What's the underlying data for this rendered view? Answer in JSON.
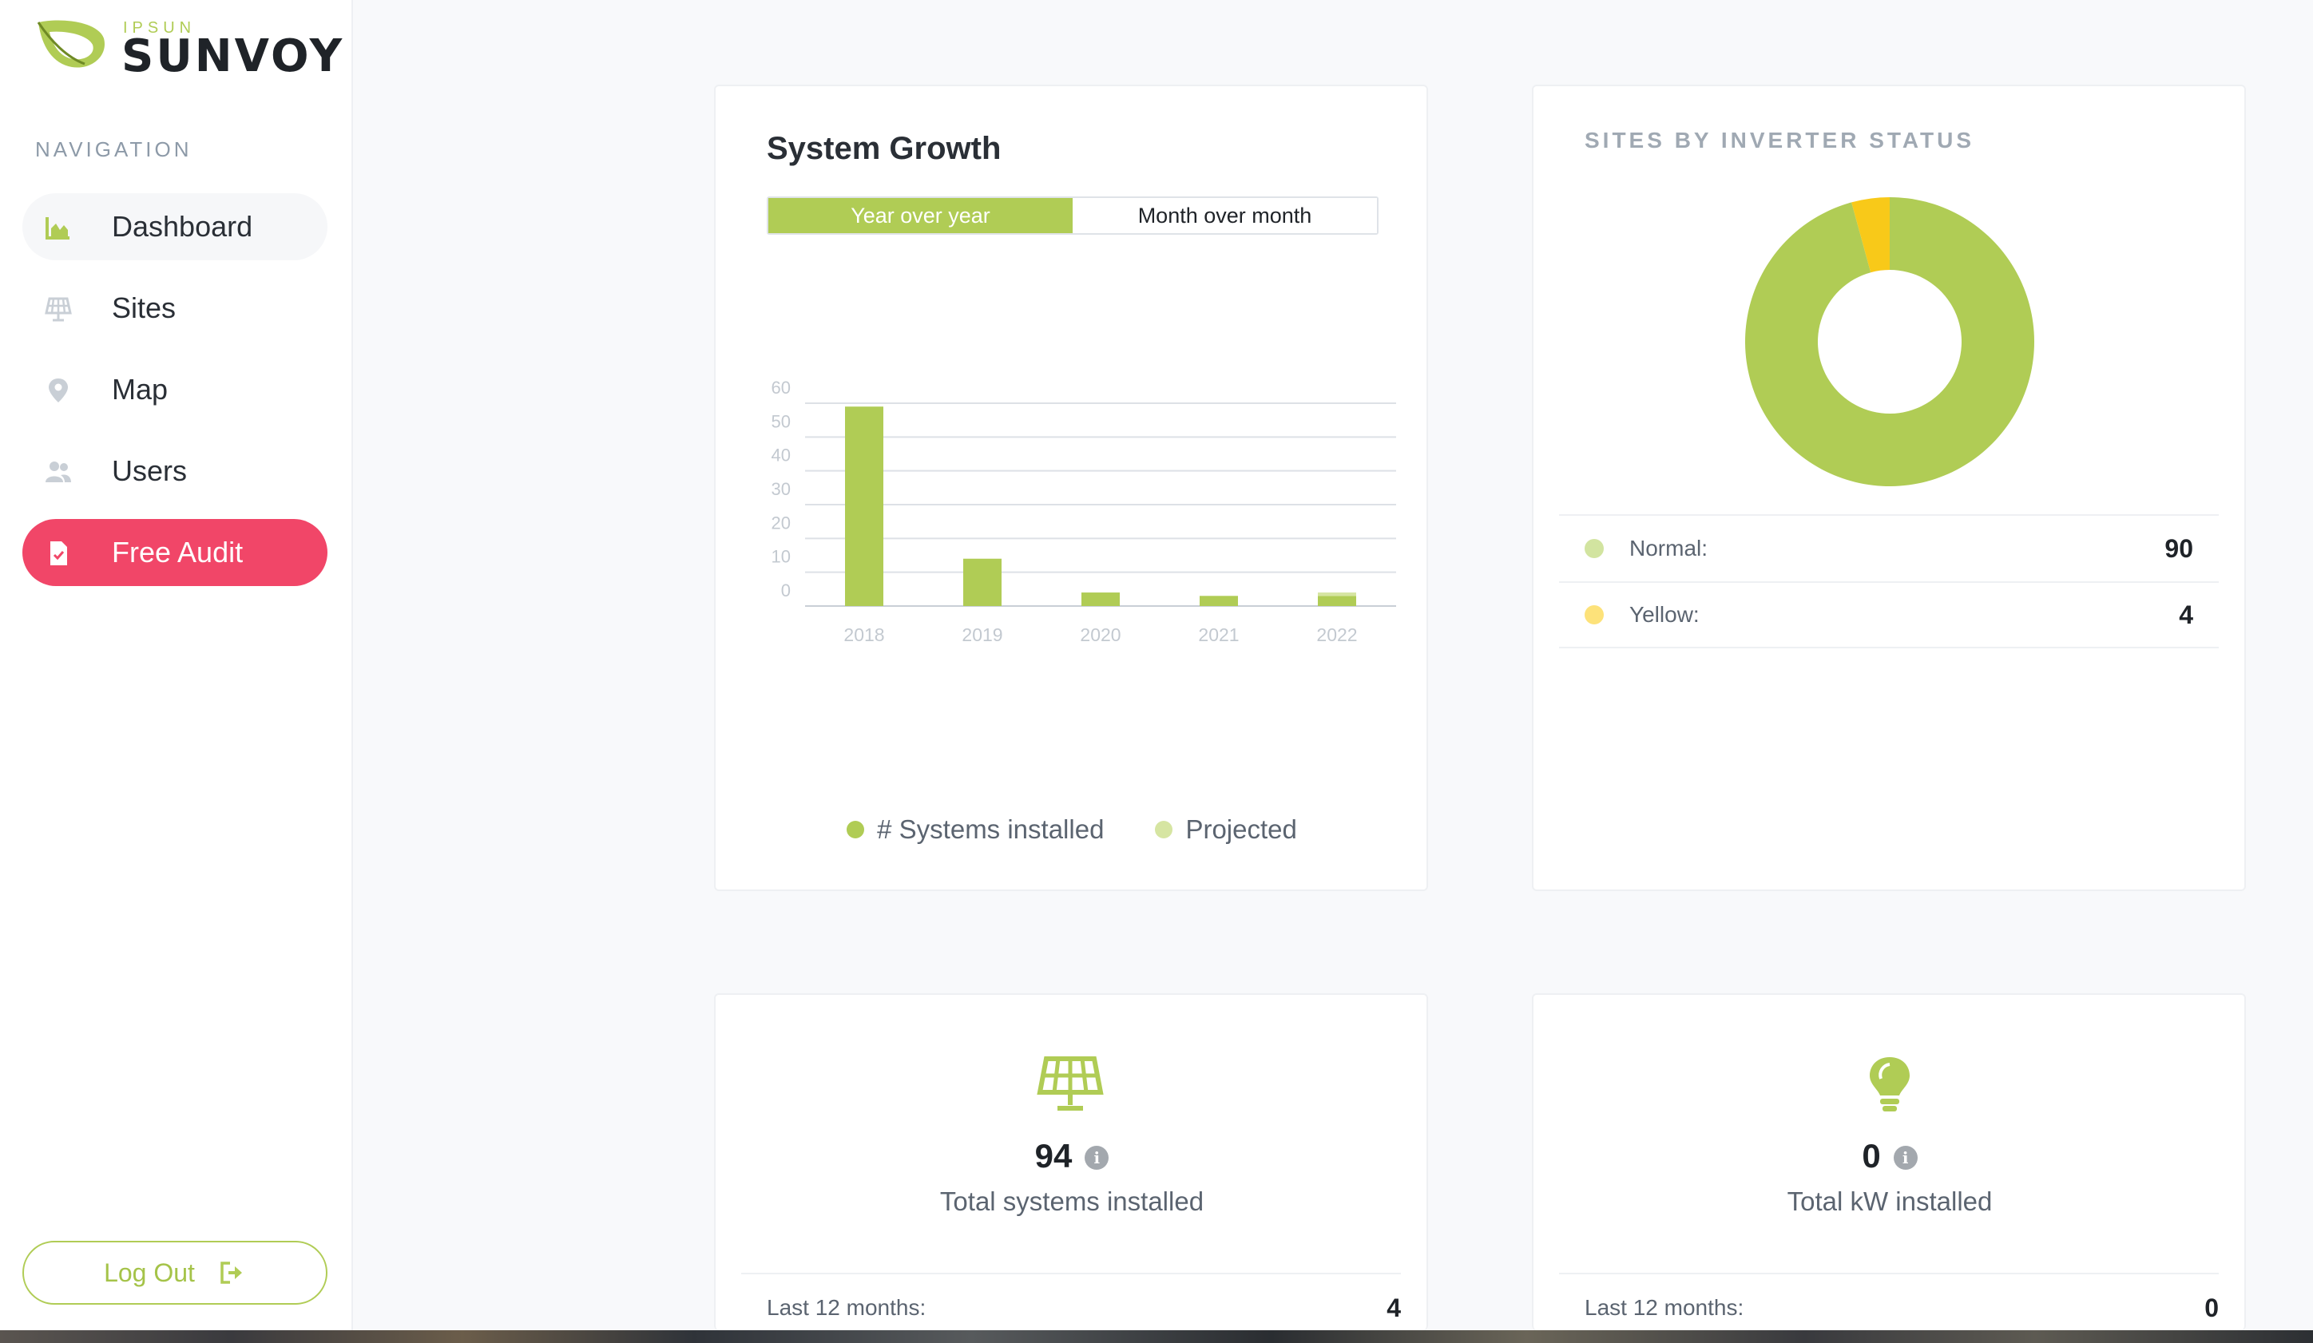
{
  "brand": {
    "small": "IPSUN",
    "big": "SUNVOY",
    "leaf_color": "#b0cc55"
  },
  "sidebar": {
    "heading": "NAVIGATION",
    "items": [
      {
        "label": "Dashboard",
        "icon": "chart-area-icon",
        "active": true
      },
      {
        "label": "Sites",
        "icon": "solar-panel-icon"
      },
      {
        "label": "Map",
        "icon": "map-pin-icon"
      },
      {
        "label": "Users",
        "icon": "users-icon"
      },
      {
        "label": "Free Audit",
        "icon": "file-check-icon",
        "accent": "#f14668"
      }
    ],
    "logout_label": "Log Out"
  },
  "growth_card": {
    "title": "System Growth",
    "toggle": {
      "active": "Year over year",
      "inactive": "Month over month"
    }
  },
  "chart_data": {
    "type": "bar",
    "categories": [
      "2018",
      "2019",
      "2020",
      "2021",
      "2022"
    ],
    "series": [
      {
        "name": "# Systems installed",
        "values": [
          59,
          14,
          4,
          3,
          3
        ],
        "color": "#b0cc55"
      },
      {
        "name": "Projected",
        "values": [
          0,
          0,
          0,
          0,
          1
        ],
        "color": "#d6e5a2"
      }
    ],
    "stacked": true,
    "ylim": [
      0,
      60
    ],
    "yticks": [
      "0",
      "10",
      "20",
      "30",
      "40",
      "50",
      "60"
    ],
    "grid": true,
    "legend": "bottom"
  },
  "status_card": {
    "title": "SITES BY INVERTER STATUS",
    "donut": [
      {
        "label": "Normal:",
        "value": 90,
        "color": "#b0cc55",
        "dot_color": "#d2e4a0"
      },
      {
        "label": "Yellow:",
        "value": 4,
        "color": "#f8c919",
        "dot_color": "#fde27a"
      }
    ]
  },
  "kpis": [
    {
      "icon": "solar-panel-icon",
      "value": "94",
      "label": "Total systems installed",
      "foot_label": "Last 12 months:",
      "foot_value": "4"
    },
    {
      "icon": "lightbulb-icon",
      "value": "0",
      "label": "Total kW installed",
      "foot_label": "Last 12 months:",
      "foot_value": "0"
    }
  ]
}
